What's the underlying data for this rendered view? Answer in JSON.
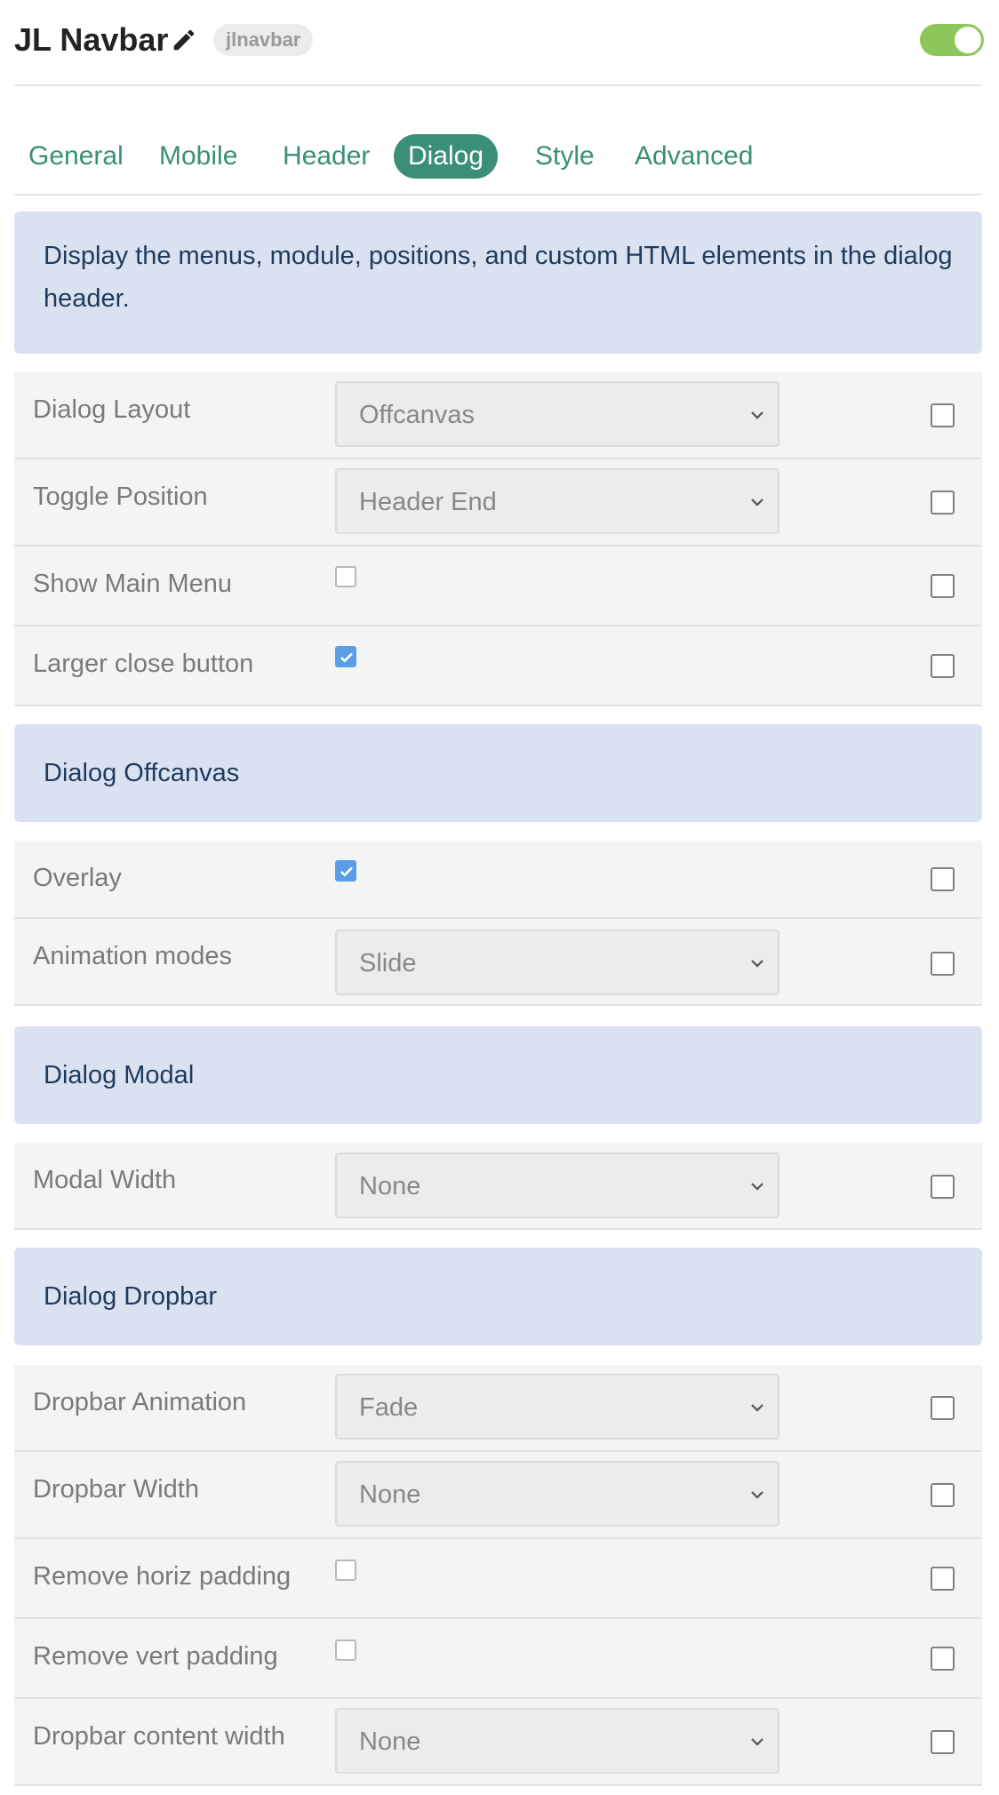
{
  "header": {
    "title": "JL Navbar",
    "badge": "jlnavbar",
    "toggle_on": true
  },
  "tabs": [
    {
      "label": "General",
      "active": false
    },
    {
      "label": "Mobile",
      "active": false
    },
    {
      "label": "Header",
      "active": false
    },
    {
      "label": "Dialog",
      "active": true
    },
    {
      "label": "Style",
      "active": false
    },
    {
      "label": "Advanced",
      "active": false
    }
  ],
  "description": "Display the menus, module, positions, and custom HTML elements in the dialog header.",
  "fields": {
    "dialog_layout": {
      "label": "Dialog Layout",
      "value": "Offcanvas"
    },
    "toggle_position": {
      "label": "Toggle Position",
      "value": "Header End"
    },
    "show_main_menu": {
      "label": "Show Main Menu",
      "checked": false
    },
    "larger_close_button": {
      "label": "Larger close button",
      "checked": true
    },
    "overlay": {
      "label": "Overlay",
      "checked": true
    },
    "animation_modes": {
      "label": "Animation modes",
      "value": "Slide"
    },
    "modal_width": {
      "label": "Modal Width",
      "value": "None"
    },
    "dropbar_animation": {
      "label": "Dropbar Animation",
      "value": "Fade"
    },
    "dropbar_width": {
      "label": "Dropbar Width",
      "value": "None"
    },
    "remove_horiz_padding": {
      "label": "Remove horiz padding",
      "checked": false
    },
    "remove_vert_padding": {
      "label": "Remove vert padding",
      "checked": false
    },
    "dropbar_content_width": {
      "label": "Dropbar content width",
      "value": "None"
    }
  },
  "sections": {
    "offcanvas": "Dialog Offcanvas",
    "modal": "Dialog Modal",
    "dropbar": "Dialog Dropbar"
  },
  "colors": {
    "accent": "#3a8f76",
    "toggle": "#8dc65a",
    "info_bg": "#dae2f1",
    "checkbox_checked": "#5b9ee8"
  },
  "icons": {
    "edit": "pencil-icon",
    "select_arrow": "chevron-down-icon",
    "check": "check-icon"
  }
}
